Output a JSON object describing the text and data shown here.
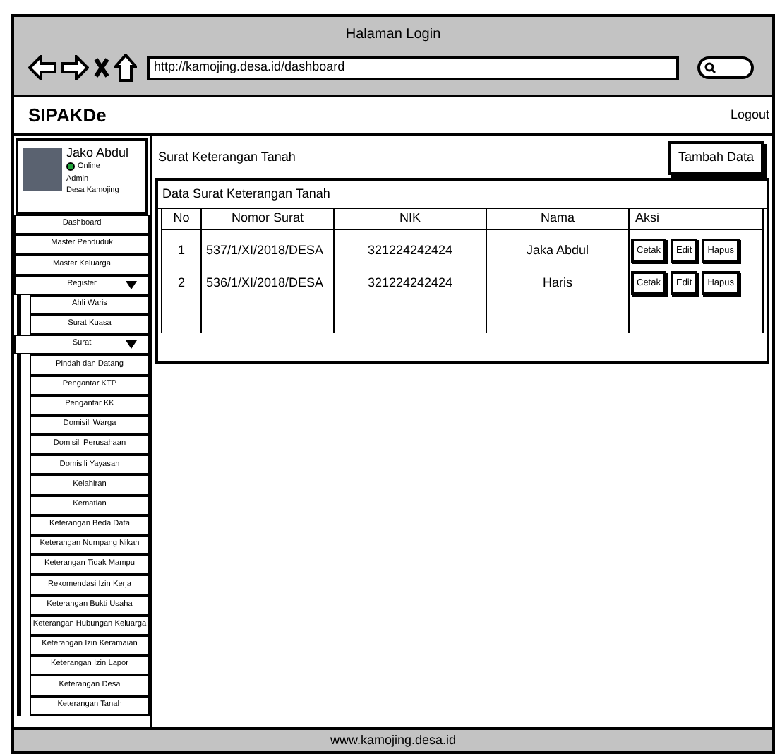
{
  "browser": {
    "title": "Halaman Login",
    "url": "http://kamojing.desa.id/dashboard"
  },
  "header": {
    "brand": "SIPAKDe",
    "logout": "Logout"
  },
  "profile": {
    "name": "Jako Abdul",
    "status": "Online",
    "online": true,
    "role": "Admin",
    "place": "Desa Kamojing"
  },
  "sidebar": {
    "items": [
      {
        "label": "Dashboard",
        "kind": "item"
      },
      {
        "label": "Master Penduduk",
        "kind": "item"
      },
      {
        "label": "Master Keluarga",
        "kind": "item"
      },
      {
        "label": "Register",
        "kind": "group",
        "expanded": true,
        "children": [
          {
            "label": "Ahli Waris"
          },
          {
            "label": "Surat Kuasa"
          }
        ]
      },
      {
        "label": "Surat",
        "kind": "group",
        "expanded": true,
        "children": [
          {
            "label": "Pindah dan Datang"
          },
          {
            "label": "Pengantar KTP"
          },
          {
            "label": "Pengantar KK"
          },
          {
            "label": "Domisili Warga"
          },
          {
            "label": "Domisili Perusahaan"
          },
          {
            "label": "Domisili Yayasan"
          },
          {
            "label": "Kelahiran"
          },
          {
            "label": "Kematian"
          },
          {
            "label": "Keterangan Beda Data"
          },
          {
            "label": "Keterangan Numpang Nikah"
          },
          {
            "label": "Keterangan Tidak Mampu"
          },
          {
            "label": "Rekomendasi Izin Kerja"
          },
          {
            "label": "Keterangan Bukti Usaha"
          },
          {
            "label": "Keterangan Hubungan Keluarga"
          },
          {
            "label": "Keterangan Izin Keramaian"
          },
          {
            "label": "Keterangan Izin Lapor"
          },
          {
            "label": "Keterangan Desa"
          },
          {
            "label": "Keterangan Tanah"
          }
        ]
      }
    ]
  },
  "page": {
    "title": "Surat Keterangan Tanah",
    "add_button": "Tambah Data"
  },
  "table": {
    "title": "Data Surat Keterangan Tanah",
    "columns": [
      "No",
      "Nomor Surat",
      "NIK",
      "Nama",
      "Aksi"
    ],
    "rows": [
      {
        "no": "1",
        "nomor": "537/1/XI/2018/DESA",
        "nik": "321224242424",
        "nama": "Jaka Abdul",
        "actions": [
          "Cetak",
          "Edit",
          "Hapus"
        ]
      },
      {
        "no": "2",
        "nomor": "536/1/XI/2018/DESA",
        "nik": "321224242424",
        "nama": "Haris",
        "actions": [
          "Cetak",
          "Edit",
          "Hapus"
        ]
      }
    ]
  },
  "footer": {
    "text": "www.kamojing.desa.id"
  }
}
